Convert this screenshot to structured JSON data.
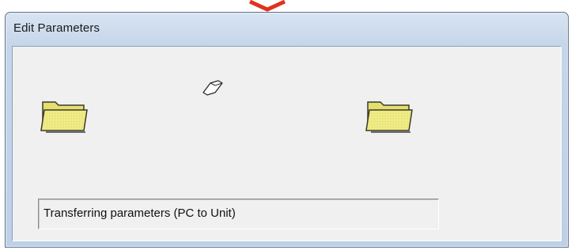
{
  "window": {
    "title": "Edit Parameters"
  },
  "transfer": {
    "source_icon": "folder-icon",
    "moving_item_icon": "paper-icon",
    "destination_icon": "folder-icon"
  },
  "status": {
    "text": "Transferring parameters (PC to Unit)"
  },
  "colors": {
    "titlebar": "#c6d6ea",
    "client_bg": "#f0f0f0",
    "folder_fill": "#f1ee8f",
    "callout_arrow": "#e0321c"
  }
}
